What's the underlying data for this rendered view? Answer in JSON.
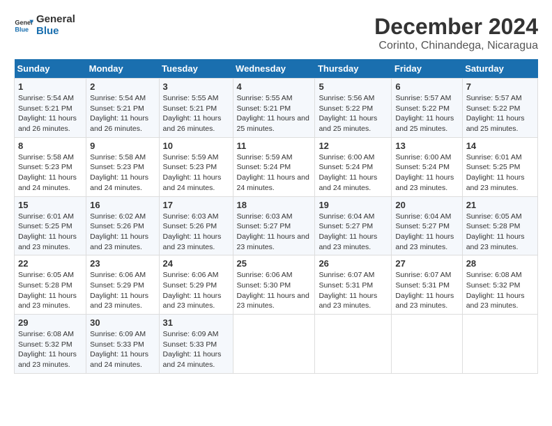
{
  "logo": {
    "general": "General",
    "blue": "Blue"
  },
  "title": "December 2024",
  "subtitle": "Corinto, Chinandega, Nicaragua",
  "days_of_week": [
    "Sunday",
    "Monday",
    "Tuesday",
    "Wednesday",
    "Thursday",
    "Friday",
    "Saturday"
  ],
  "weeks": [
    [
      {
        "day": "1",
        "sunrise": "Sunrise: 5:54 AM",
        "sunset": "Sunset: 5:21 PM",
        "daylight": "Daylight: 11 hours and 26 minutes."
      },
      {
        "day": "2",
        "sunrise": "Sunrise: 5:54 AM",
        "sunset": "Sunset: 5:21 PM",
        "daylight": "Daylight: 11 hours and 26 minutes."
      },
      {
        "day": "3",
        "sunrise": "Sunrise: 5:55 AM",
        "sunset": "Sunset: 5:21 PM",
        "daylight": "Daylight: 11 hours and 26 minutes."
      },
      {
        "day": "4",
        "sunrise": "Sunrise: 5:55 AM",
        "sunset": "Sunset: 5:21 PM",
        "daylight": "Daylight: 11 hours and 25 minutes."
      },
      {
        "day": "5",
        "sunrise": "Sunrise: 5:56 AM",
        "sunset": "Sunset: 5:22 PM",
        "daylight": "Daylight: 11 hours and 25 minutes."
      },
      {
        "day": "6",
        "sunrise": "Sunrise: 5:57 AM",
        "sunset": "Sunset: 5:22 PM",
        "daylight": "Daylight: 11 hours and 25 minutes."
      },
      {
        "day": "7",
        "sunrise": "Sunrise: 5:57 AM",
        "sunset": "Sunset: 5:22 PM",
        "daylight": "Daylight: 11 hours and 25 minutes."
      }
    ],
    [
      {
        "day": "8",
        "sunrise": "Sunrise: 5:58 AM",
        "sunset": "Sunset: 5:23 PM",
        "daylight": "Daylight: 11 hours and 24 minutes."
      },
      {
        "day": "9",
        "sunrise": "Sunrise: 5:58 AM",
        "sunset": "Sunset: 5:23 PM",
        "daylight": "Daylight: 11 hours and 24 minutes."
      },
      {
        "day": "10",
        "sunrise": "Sunrise: 5:59 AM",
        "sunset": "Sunset: 5:23 PM",
        "daylight": "Daylight: 11 hours and 24 minutes."
      },
      {
        "day": "11",
        "sunrise": "Sunrise: 5:59 AM",
        "sunset": "Sunset: 5:24 PM",
        "daylight": "Daylight: 11 hours and 24 minutes."
      },
      {
        "day": "12",
        "sunrise": "Sunrise: 6:00 AM",
        "sunset": "Sunset: 5:24 PM",
        "daylight": "Daylight: 11 hours and 24 minutes."
      },
      {
        "day": "13",
        "sunrise": "Sunrise: 6:00 AM",
        "sunset": "Sunset: 5:24 PM",
        "daylight": "Daylight: 11 hours and 23 minutes."
      },
      {
        "day": "14",
        "sunrise": "Sunrise: 6:01 AM",
        "sunset": "Sunset: 5:25 PM",
        "daylight": "Daylight: 11 hours and 23 minutes."
      }
    ],
    [
      {
        "day": "15",
        "sunrise": "Sunrise: 6:01 AM",
        "sunset": "Sunset: 5:25 PM",
        "daylight": "Daylight: 11 hours and 23 minutes."
      },
      {
        "day": "16",
        "sunrise": "Sunrise: 6:02 AM",
        "sunset": "Sunset: 5:26 PM",
        "daylight": "Daylight: 11 hours and 23 minutes."
      },
      {
        "day": "17",
        "sunrise": "Sunrise: 6:03 AM",
        "sunset": "Sunset: 5:26 PM",
        "daylight": "Daylight: 11 hours and 23 minutes."
      },
      {
        "day": "18",
        "sunrise": "Sunrise: 6:03 AM",
        "sunset": "Sunset: 5:27 PM",
        "daylight": "Daylight: 11 hours and 23 minutes."
      },
      {
        "day": "19",
        "sunrise": "Sunrise: 6:04 AM",
        "sunset": "Sunset: 5:27 PM",
        "daylight": "Daylight: 11 hours and 23 minutes."
      },
      {
        "day": "20",
        "sunrise": "Sunrise: 6:04 AM",
        "sunset": "Sunset: 5:27 PM",
        "daylight": "Daylight: 11 hours and 23 minutes."
      },
      {
        "day": "21",
        "sunrise": "Sunrise: 6:05 AM",
        "sunset": "Sunset: 5:28 PM",
        "daylight": "Daylight: 11 hours and 23 minutes."
      }
    ],
    [
      {
        "day": "22",
        "sunrise": "Sunrise: 6:05 AM",
        "sunset": "Sunset: 5:28 PM",
        "daylight": "Daylight: 11 hours and 23 minutes."
      },
      {
        "day": "23",
        "sunrise": "Sunrise: 6:06 AM",
        "sunset": "Sunset: 5:29 PM",
        "daylight": "Daylight: 11 hours and 23 minutes."
      },
      {
        "day": "24",
        "sunrise": "Sunrise: 6:06 AM",
        "sunset": "Sunset: 5:29 PM",
        "daylight": "Daylight: 11 hours and 23 minutes."
      },
      {
        "day": "25",
        "sunrise": "Sunrise: 6:06 AM",
        "sunset": "Sunset: 5:30 PM",
        "daylight": "Daylight: 11 hours and 23 minutes."
      },
      {
        "day": "26",
        "sunrise": "Sunrise: 6:07 AM",
        "sunset": "Sunset: 5:31 PM",
        "daylight": "Daylight: 11 hours and 23 minutes."
      },
      {
        "day": "27",
        "sunrise": "Sunrise: 6:07 AM",
        "sunset": "Sunset: 5:31 PM",
        "daylight": "Daylight: 11 hours and 23 minutes."
      },
      {
        "day": "28",
        "sunrise": "Sunrise: 6:08 AM",
        "sunset": "Sunset: 5:32 PM",
        "daylight": "Daylight: 11 hours and 23 minutes."
      }
    ],
    [
      {
        "day": "29",
        "sunrise": "Sunrise: 6:08 AM",
        "sunset": "Sunset: 5:32 PM",
        "daylight": "Daylight: 11 hours and 23 minutes."
      },
      {
        "day": "30",
        "sunrise": "Sunrise: 6:09 AM",
        "sunset": "Sunset: 5:33 PM",
        "daylight": "Daylight: 11 hours and 24 minutes."
      },
      {
        "day": "31",
        "sunrise": "Sunrise: 6:09 AM",
        "sunset": "Sunset: 5:33 PM",
        "daylight": "Daylight: 11 hours and 24 minutes."
      },
      null,
      null,
      null,
      null
    ]
  ]
}
